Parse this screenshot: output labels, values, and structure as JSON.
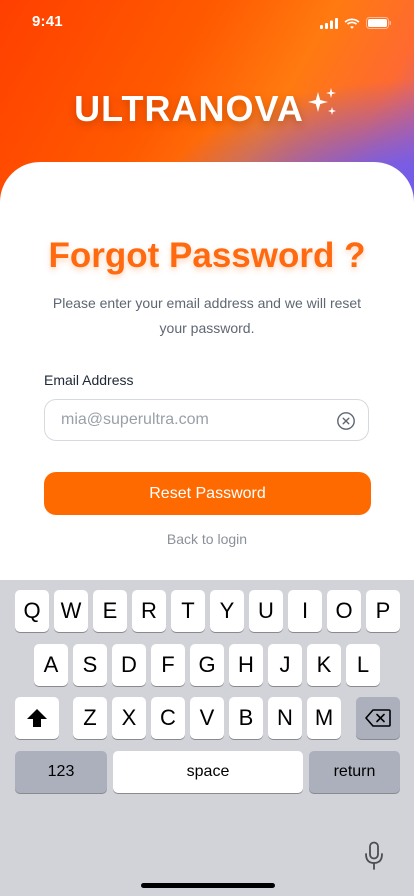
{
  "status_bar": {
    "time": "9:41"
  },
  "brand": {
    "logo_text": "ULTRANOVA"
  },
  "screen": {
    "title": "Forgot Password ?",
    "subtitle": "Please enter your email address and we will reset your password."
  },
  "form": {
    "email_label": "Email Address",
    "email_placeholder": "mia@superultra.com",
    "email_value": "",
    "submit_label": "Reset Password",
    "back_link": "Back to login"
  },
  "keyboard": {
    "row1": [
      "Q",
      "W",
      "E",
      "R",
      "T",
      "Y",
      "U",
      "I",
      "O",
      "P"
    ],
    "row2": [
      "A",
      "S",
      "D",
      "F",
      "G",
      "H",
      "J",
      "K",
      "L"
    ],
    "row3": [
      "Z",
      "X",
      "C",
      "V",
      "B",
      "N",
      "M"
    ],
    "numbers_key": "123",
    "space_key": "space",
    "return_key": "return"
  },
  "colors": {
    "accent": "#ff6a00",
    "hero_start": "#ff3f00",
    "hero_end": "#6b5cf2",
    "keyboard_bg": "#d1d3d9"
  },
  "icons": {
    "status": [
      "signal-icon",
      "wifi-icon",
      "battery-icon"
    ],
    "logo": "sparkle-icon",
    "clear": "clear-icon",
    "shift": "shift-icon",
    "delete": "backspace-icon",
    "dictation": "microphone-icon"
  }
}
